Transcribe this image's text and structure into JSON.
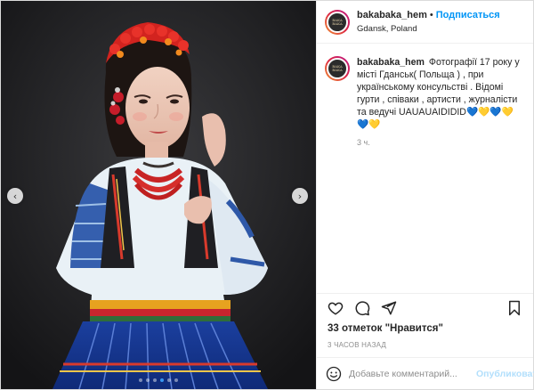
{
  "post": {
    "username": "bakabaka_hem",
    "separator": "•",
    "follow_label": "Подписаться",
    "location": "Gdansk, Poland",
    "avatar_text": "BAKA BAKA",
    "caption_text": "Фотографії 17 року у місті Гданськ( Польща ) , при українському консульстві . Відомі гурти , співаки , артисти , журналісти та ведучі UAUAUAIDIDID",
    "caption_hearts": [
      "💙",
      "💛",
      "💙",
      "💛",
      "💙",
      "💛"
    ],
    "comment_time": "3 ч.",
    "likes_label": "33 отметок \"Нравится\"",
    "date_label": "3 часов назад",
    "comment_placeholder": "Добавьте комментарий...",
    "publish_label": "Опубликовать"
  },
  "carousel": {
    "slide_count": 6,
    "active_index": 3
  },
  "icons": {
    "prev": "chevron-left-icon",
    "next": "chevron-right-icon",
    "like": "heart-icon",
    "comment": "comment-icon",
    "share": "share-icon",
    "save": "bookmark-icon",
    "emoji": "emoji-icon"
  },
  "colors": {
    "accent": "#0095f6",
    "publish_disabled": "#b2dffc",
    "heart_blue": "#2a6fdb",
    "heart_yellow": "#f2c200",
    "photo_background": "#1c1c1e"
  }
}
